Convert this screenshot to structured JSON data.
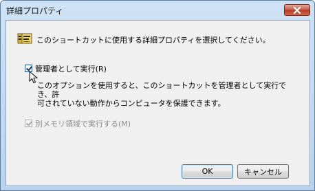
{
  "window": {
    "title": "詳細プロパティ"
  },
  "dialog": {
    "description": "このショートカットに使用する詳細プロパティを選択してください。",
    "run_as_admin": {
      "label": "管理者として実行(R)",
      "checked": true,
      "help": "このオプションを使用すると、このショートカットを管理者として実行でき、許\n可されていない動作からコンピュータを保護できます。"
    },
    "separate_memory": {
      "label": "別メモリ領域で実行する(M)",
      "checked": true,
      "disabled": true
    }
  },
  "buttons": {
    "ok": "OK",
    "cancel": "キャンセル"
  },
  "icons": {
    "close": "close-icon",
    "properties": "properties-icon",
    "cursor": "mouse-pointer-icon"
  },
  "colors": {
    "title_bar": "#b9d3ee",
    "close_button": "#c75844",
    "client_bg": "#f0f0f0"
  }
}
